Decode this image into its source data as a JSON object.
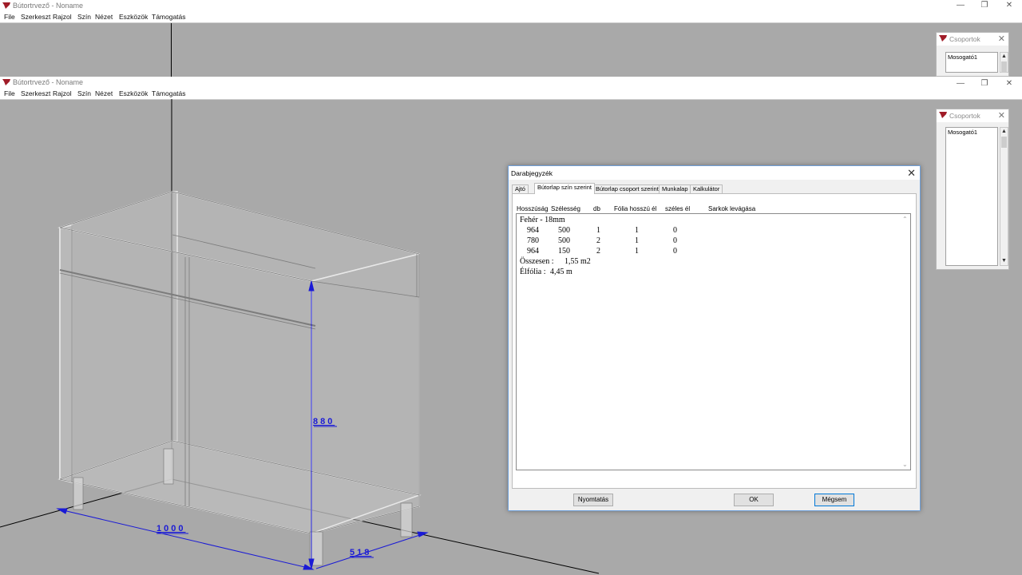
{
  "app": {
    "window_title": "Bútortrvező - Noname",
    "menu": [
      "File",
      "Szerkeszt",
      "Rajzol",
      "Szín",
      "Nézet",
      "Eszközök",
      "Támogatás"
    ]
  },
  "groups_panel": {
    "title": "Csoportok",
    "items": [
      "Mosogató1"
    ]
  },
  "dialog": {
    "title": "Darabjegyzék",
    "tabs": [
      "Ajtó",
      "Bútorlap szín szerint",
      "Bútorlap csoport szerint",
      "Munkalap",
      "Kalkulátor"
    ],
    "active_tab": "Bútorlap szín szerint",
    "columns": [
      "Hosszúság",
      "Szélesség",
      "db",
      "Fólia hosszú él",
      "széles él",
      "Sarkok levágása"
    ],
    "group_name": "Fehér - 18mm",
    "rows": [
      {
        "length": "964",
        "width": "500",
        "count": "1",
        "long_edge": "1",
        "wide_edge": "0"
      },
      {
        "length": "780",
        "width": "500",
        "count": "2",
        "long_edge": "1",
        "wide_edge": "0"
      },
      {
        "length": "964",
        "width": "150",
        "count": "2",
        "long_edge": "1",
        "wide_edge": "0"
      }
    ],
    "total_label": "Összesen :",
    "total_value": "1,55 m2",
    "edge_label": "Élfólia :",
    "edge_value": "4,45 m",
    "buttons": {
      "print": "Nyomtatás",
      "ok": "OK",
      "cancel": "Mégsem"
    }
  },
  "dimensions": {
    "height": "880",
    "width": "1000",
    "depth": "518"
  },
  "colors": {
    "accent": "#0078d7",
    "dimension": "#1a1ad6",
    "icon": "#a01c28",
    "canvas": "#a9a9a9"
  }
}
